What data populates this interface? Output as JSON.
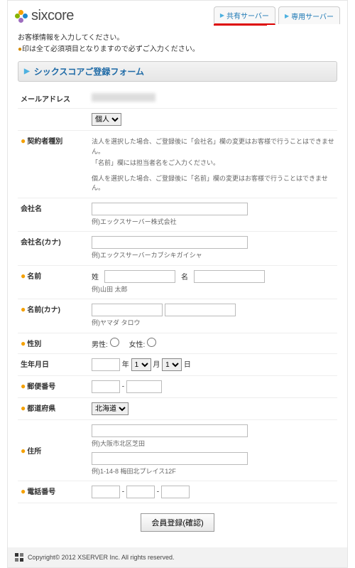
{
  "header": {
    "logo_text": "sixcore",
    "tabs": [
      {
        "label": "共有サーバー",
        "active": true
      },
      {
        "label": "専用サーバー",
        "active": false
      }
    ]
  },
  "intro": {
    "line1": "お客様情報を入力してください。",
    "req_mark": "●",
    "line2": "印は全て必須項目となりますので必ずご入力ください。"
  },
  "section_title": "シックスコアご登録フォーム",
  "form": {
    "email_label": "メールアドレス",
    "account_type_select": "個人",
    "contractor_label": "契約者種別",
    "contractor_note1": "法人を選択した場合、ご登録後に「会社名」欄の変更はお客様で行うことはできません。",
    "contractor_note2": "「名前」欄には担当者名をご入力ください。",
    "contractor_note3": "個人を選択した場合、ご登録後に「名前」欄の変更はお客様で行うことはできません。",
    "company_label": "会社名",
    "company_hint": "例)エックスサーバー株式会社",
    "company_kana_label": "会社名(カナ)",
    "company_kana_hint": "例)エックスサーバーカブシキガイシャ",
    "name_label": "名前",
    "name_sei": "姓",
    "name_mei": "名",
    "name_hint": "例)山田 太郎",
    "name_kana_label": "名前(カナ)",
    "name_kana_hint": "例)ヤマダ タロウ",
    "gender_label": "性別",
    "gender_male": "男性:",
    "gender_female": "女性:",
    "birth_label": "生年月日",
    "birth_year_suffix": "年",
    "birth_month": "1",
    "birth_month_suffix": "月",
    "birth_day": "1",
    "birth_day_suffix": "日",
    "postal_label": "郵便番号",
    "postal_sep": "-",
    "pref_label": "都道府県",
    "pref_value": "北海道",
    "address_label": "住所",
    "address_hint1": "例)大阪市北区芝田",
    "address_hint2": "例)1-14-8 梅田北プレイス12F",
    "phone_label": "電話番号",
    "phone_sep": "-",
    "submit": "会員登録(確認)"
  },
  "footer": "Copyright© 2012 XSERVER Inc. All rights reserved."
}
